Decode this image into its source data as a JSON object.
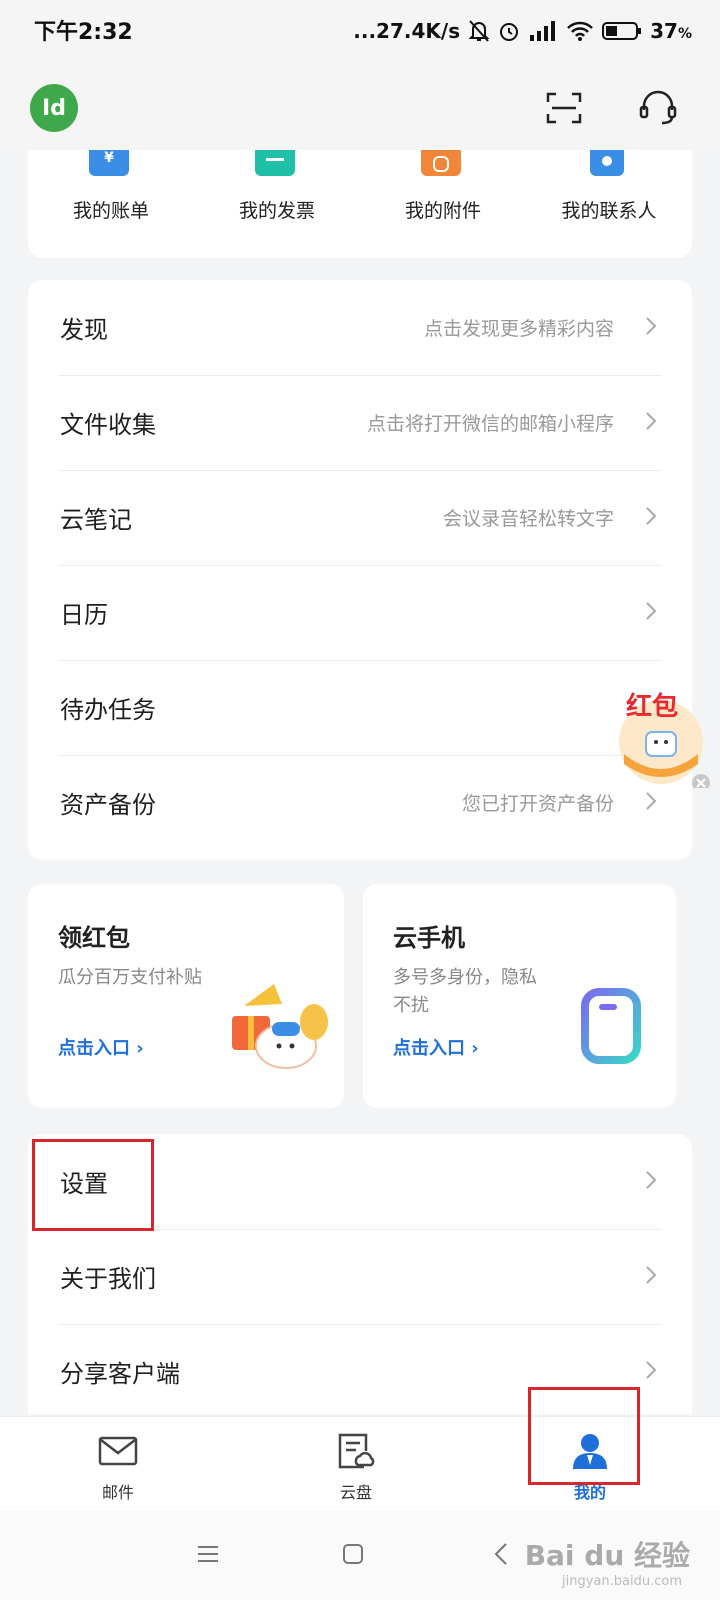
{
  "status": {
    "time": "下午2:32",
    "speed": "...27.4K/s",
    "battery": "37",
    "battery_unit": "%"
  },
  "header": {
    "avatar_text": "Id"
  },
  "quick_actions": [
    {
      "label": "我的账单",
      "color": "#3a8ee6",
      "icon": "bill-icon"
    },
    {
      "label": "我的发票",
      "color": "#1fbfa8",
      "icon": "invoice-icon"
    },
    {
      "label": "我的附件",
      "color": "#f0863a",
      "icon": "attachment-icon"
    },
    {
      "label": "我的联系人",
      "color": "#3a8ee6",
      "icon": "contacts-icon"
    }
  ],
  "list1": [
    {
      "label": "发现",
      "hint": "点击发现更多精彩内容"
    },
    {
      "label": "文件收集",
      "hint": "点击将打开微信的邮箱小程序"
    },
    {
      "label": "云笔记",
      "hint": "会议录音轻松转文字"
    },
    {
      "label": "日历",
      "hint": ""
    },
    {
      "label": "待办任务",
      "hint": ""
    },
    {
      "label": "资产备份",
      "hint": "您已打开资产备份"
    }
  ],
  "promos": [
    {
      "title": "领红包",
      "desc": "瓜分百万支付补贴",
      "link": "点击入口"
    },
    {
      "title": "云手机",
      "desc": "多号多身份，隐私不扰",
      "link": "点击入口"
    }
  ],
  "list2": [
    {
      "label": "设置"
    },
    {
      "label": "关于我们"
    },
    {
      "label": "分享客户端"
    }
  ],
  "float_badge": "红包",
  "tabs": [
    {
      "label": "邮件",
      "icon": "mail-icon"
    },
    {
      "label": "云盘",
      "icon": "cloud-drive-icon"
    },
    {
      "label": "我的",
      "icon": "profile-icon"
    }
  ],
  "watermark": {
    "brand": "Bai du 经验",
    "url": "jingyan.baidu.com"
  },
  "colors": {
    "accent": "#1e6fd9",
    "highlight": "#d9262c",
    "avatar": "#3ea84a"
  }
}
